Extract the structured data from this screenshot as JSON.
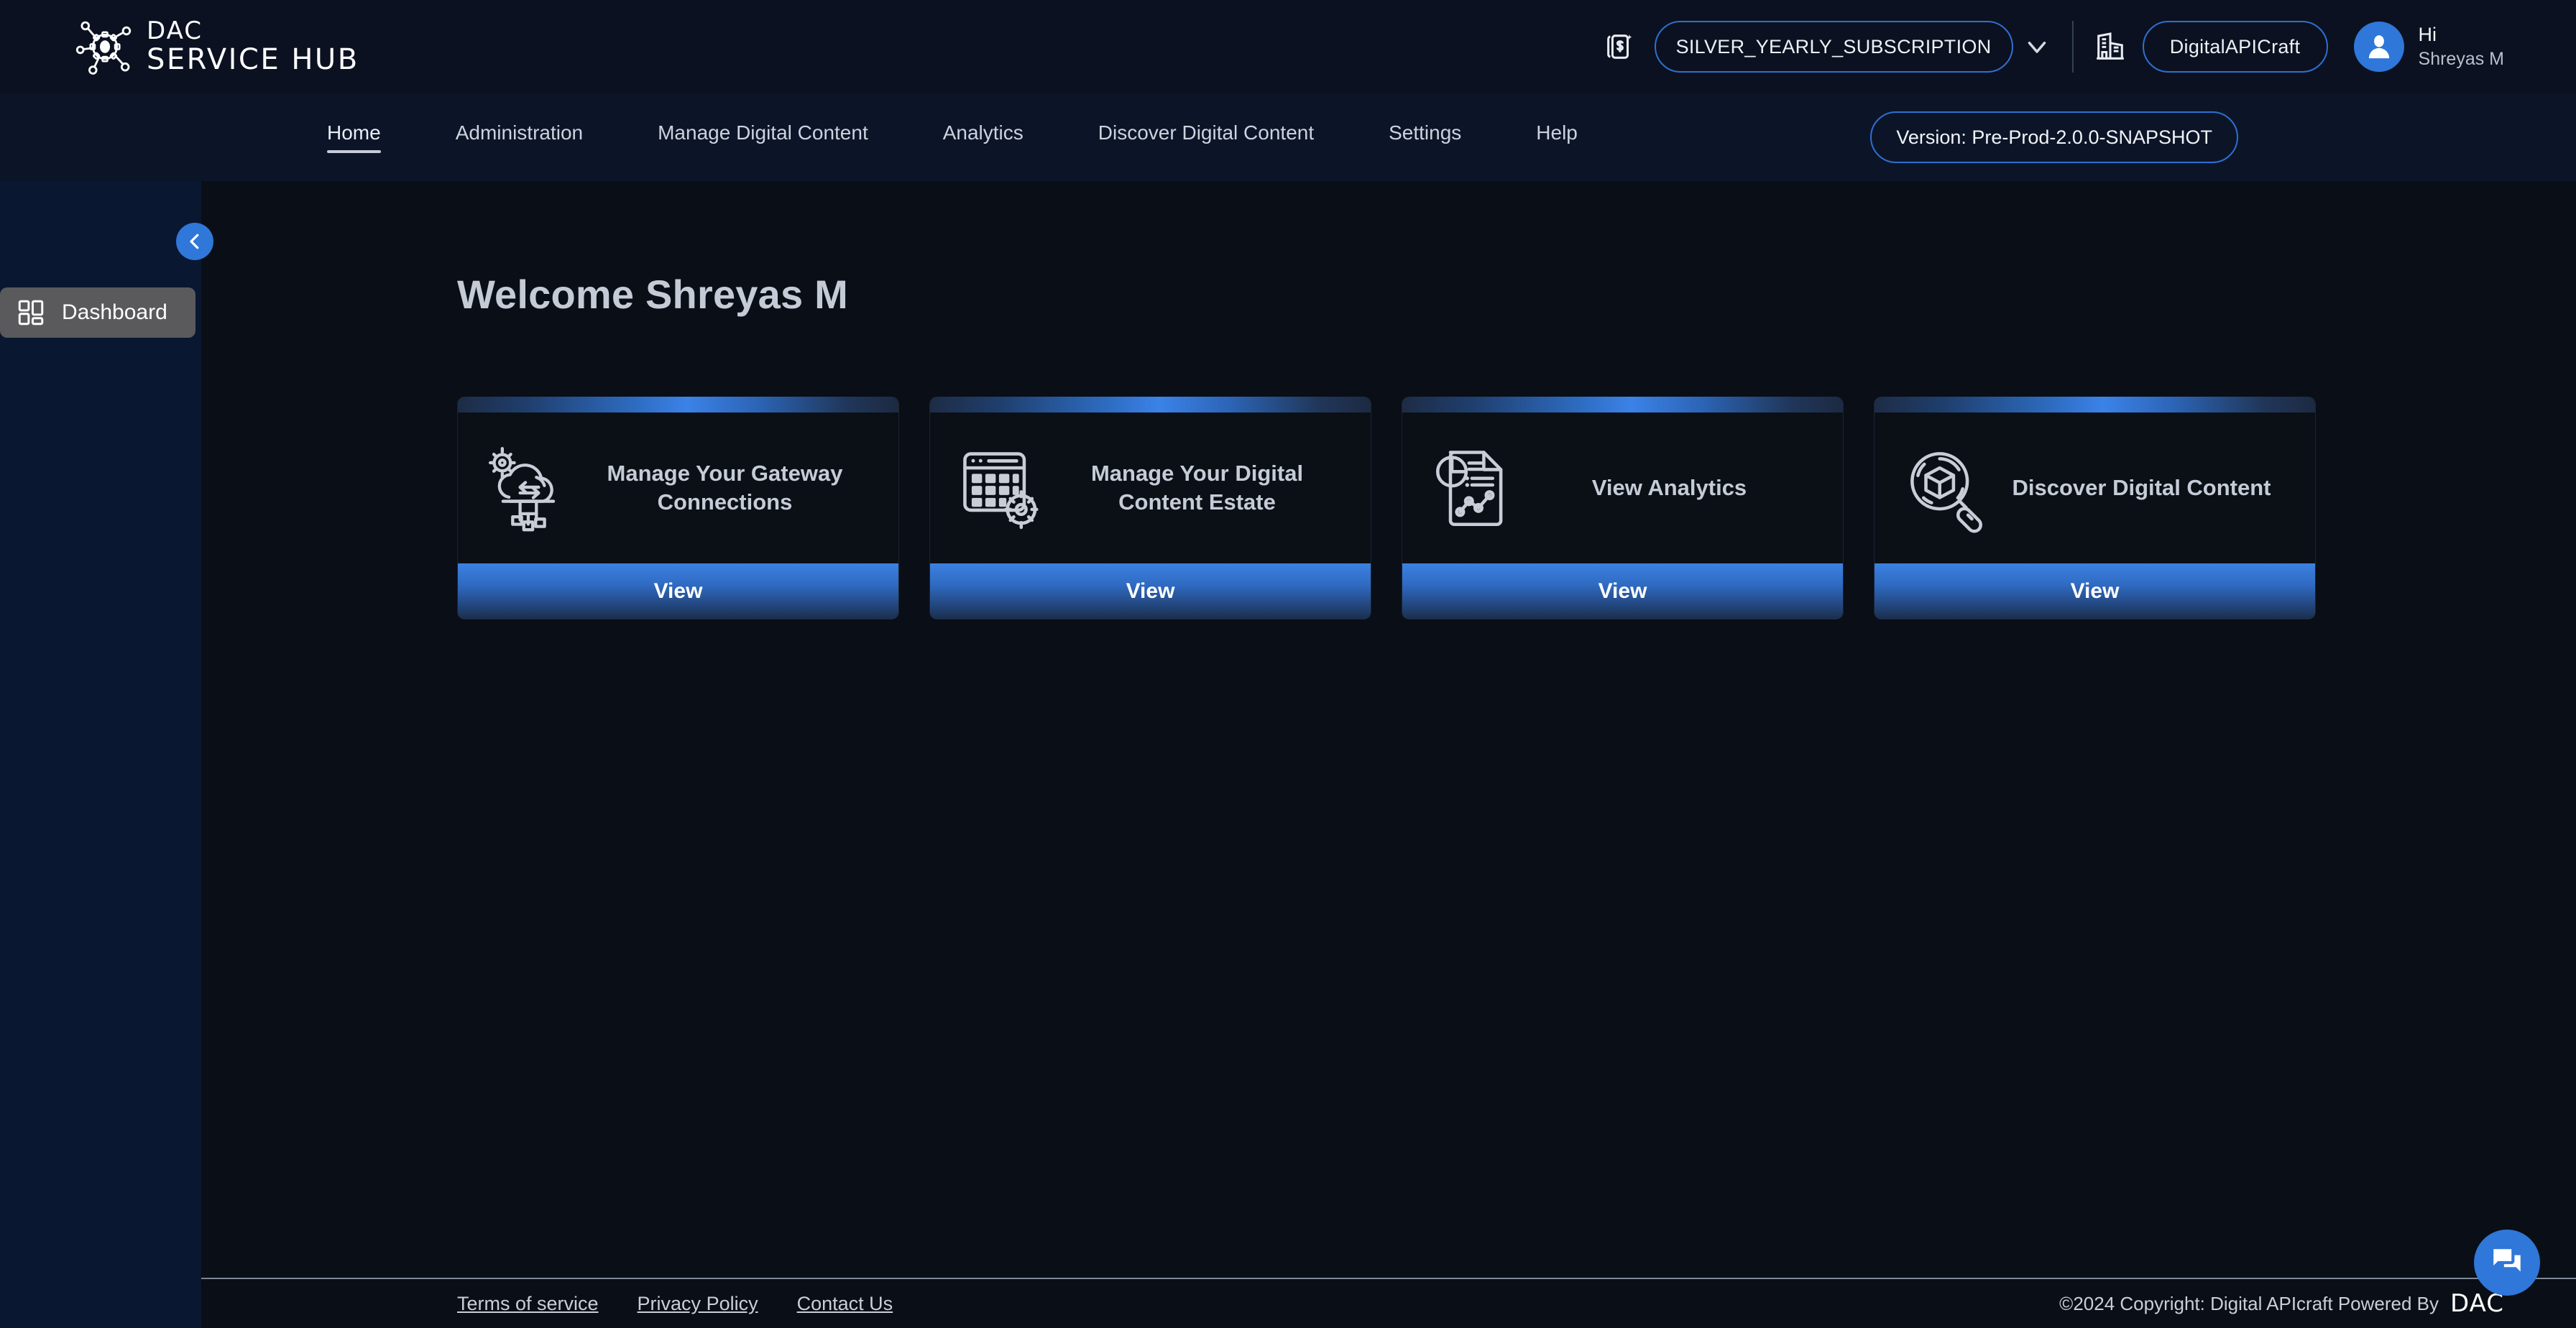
{
  "header": {
    "brand_line1": "DAC",
    "brand_line2": "SERVICE HUB",
    "brand_logo_icon": "dac-gear-network-logo",
    "subscription_icon": "money-card-icon",
    "subscription_value": "SILVER_YEARLY_SUBSCRIPTION",
    "subscription_caret_icon": "chevron-down-icon",
    "organization_icon": "building-icon",
    "organization_value": "DigitalAPICraft",
    "avatar_icon": "user-avatar-icon",
    "greeting": "Hi",
    "user_name": "Shreyas M"
  },
  "nav": {
    "items": [
      {
        "label": "Home",
        "active": true
      },
      {
        "label": "Administration",
        "active": false
      },
      {
        "label": "Manage Digital Content",
        "active": false
      },
      {
        "label": "Analytics",
        "active": false
      },
      {
        "label": "Discover Digital Content",
        "active": false
      },
      {
        "label": "Settings",
        "active": false
      },
      {
        "label": "Help",
        "active": false
      }
    ],
    "version_label": "Version: Pre-Prod-2.0.0-SNAPSHOT"
  },
  "sidebar": {
    "collapse_icon": "chevron-left-icon",
    "items": [
      {
        "label": "Dashboard",
        "icon": "dashboard-grid-icon",
        "active": true
      }
    ]
  },
  "main": {
    "welcome_title": "Welcome Shreyas M",
    "cards": [
      {
        "title": "Manage Your Gateway Connections",
        "icon": "cloud-gateway-gear-icon",
        "button_label": "View"
      },
      {
        "title": "Manage Your Digital Content Estate",
        "icon": "content-grid-gear-icon",
        "button_label": "View"
      },
      {
        "title": "View Analytics",
        "icon": "analytics-report-icon",
        "button_label": "View"
      },
      {
        "title": "Discover Digital Content",
        "icon": "magnifier-cube-icon",
        "button_label": "View"
      }
    ]
  },
  "footer": {
    "links": [
      {
        "label": "Terms of service"
      },
      {
        "label": "Privacy Policy"
      },
      {
        "label": "Contact Us"
      }
    ],
    "copyright": "©2024 Copyright: Digital APIcraft Powered By",
    "copyright_brand": "DAC"
  },
  "chat": {
    "icon": "chat-bubbles-icon"
  },
  "colors": {
    "accent_blue": "#2f77d8",
    "header_bg": "#0b1120",
    "nav_bg": "#0c1528",
    "sidebar_bg": "#0a1730",
    "main_bg": "#0a0e16",
    "card_bg": "#0b1017",
    "text_primary": "#c6ccd7",
    "border_blue": "#2f6fd0"
  }
}
